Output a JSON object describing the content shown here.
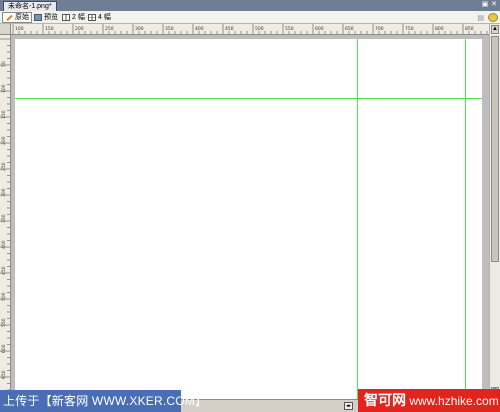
{
  "window": {
    "doc_tab": "未命名-1.png*",
    "controls": [
      "▣",
      "✕"
    ]
  },
  "toolbar": {
    "original_label": "原始",
    "preview_label": "预览",
    "two_up_label": "2 幅",
    "four_up_label": "4 幅"
  },
  "rulers": {
    "h_labels": [
      "100",
      "150",
      "200",
      "250",
      "300",
      "350",
      "400",
      "450",
      "500",
      "550",
      "600",
      "650",
      "700",
      "750",
      "800",
      "850"
    ],
    "v_labels": [
      "50",
      "100",
      "150",
      "200",
      "250",
      "300",
      "350",
      "400",
      "450",
      "500",
      "550",
      "600",
      "650"
    ]
  },
  "watermarks": {
    "left": "上传于【新客网 WWW.XKER.COM】",
    "right_brand": "智可网",
    "right_url": "www.hzhike.com"
  },
  "colors": {
    "guide": "#50e650",
    "tab_bar": "#6f7d95",
    "canvas": "#ffffff",
    "watermark_left_bg": "#4a6eb4",
    "watermark_right_bg": "#e1241c"
  }
}
